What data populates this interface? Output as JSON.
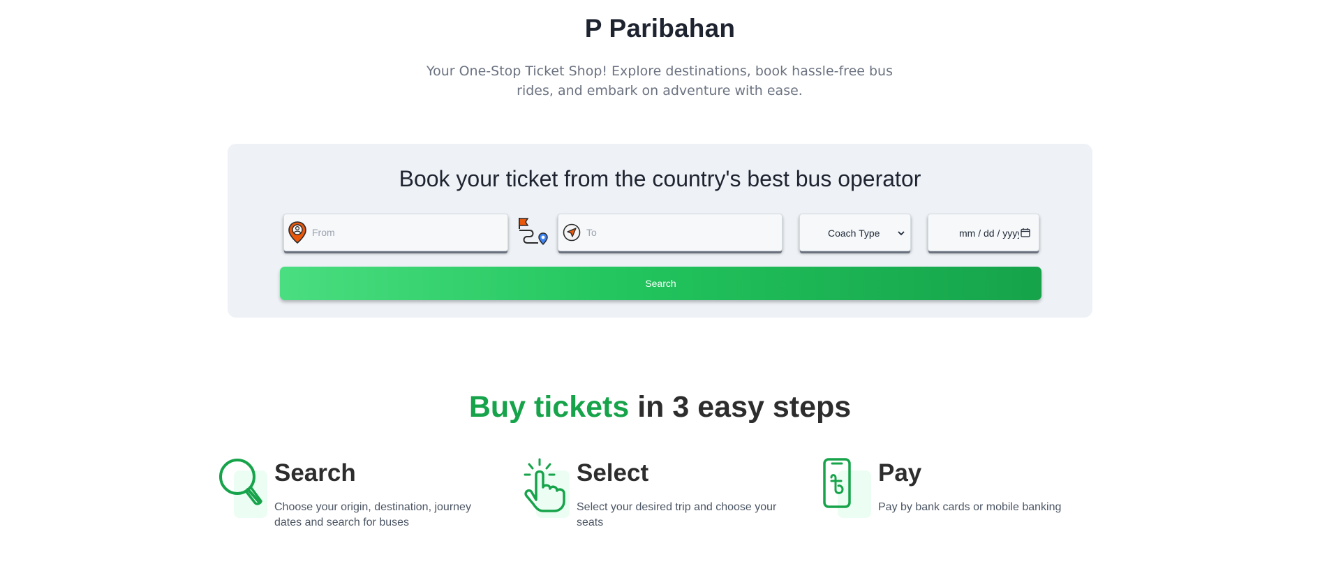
{
  "hero": {
    "title": "P Paribahan",
    "subtitle": "Your One-Stop Ticket Shop! Explore destinations, book hassle-free bus rides, and embark on adventure with ease."
  },
  "booking": {
    "heading": "Book your ticket from the country's best bus operator",
    "from_placeholder": "From",
    "to_placeholder": "To",
    "coach_type_label": "Coach Type",
    "date_placeholder": "mm / dd / yyyy",
    "search_label": "Search",
    "icons": {
      "from": "location-pin-icon",
      "route": "route-flag-icon",
      "to": "navigation-arrow-icon",
      "coach": "chevron-down-icon",
      "date": "calendar-icon"
    }
  },
  "steps": {
    "title_accent": "Buy tickets",
    "title_rest": " in 3 easy steps",
    "items": [
      {
        "title": "Search",
        "description": "Choose your origin, destination, journey dates and search for buses",
        "icon": "magnifier-icon"
      },
      {
        "title": "Select",
        "description": "Select your desired trip and choose your seats",
        "icon": "tap-hand-icon"
      },
      {
        "title": "Pay",
        "description": "Pay by bank cards or mobile banking",
        "icon": "phone-taka-icon"
      }
    ]
  },
  "colors": {
    "accent_green": "#16a34a",
    "panel_bg": "#eef2f6",
    "pin_orange": "#ea580c"
  }
}
